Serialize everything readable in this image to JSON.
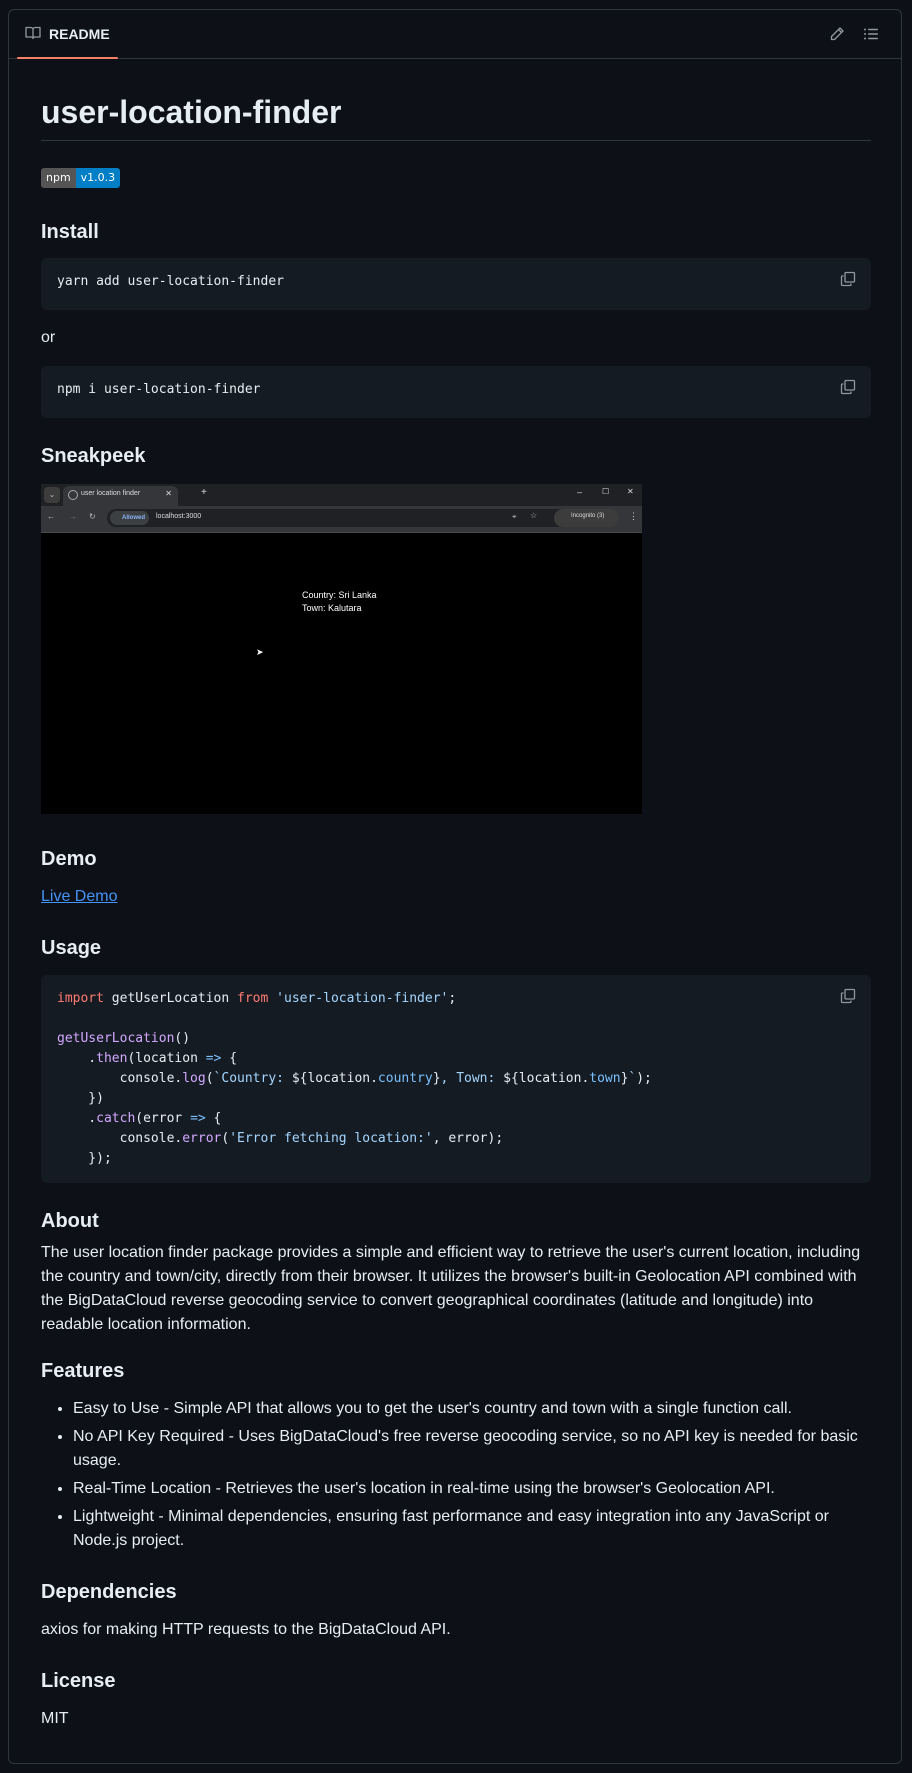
{
  "header": {
    "tab_label": "README"
  },
  "title": "user-location-finder",
  "badge": {
    "left": "npm",
    "right": "v1.0.3"
  },
  "install": {
    "heading": "Install",
    "cmd1": "yarn add user-location-finder",
    "or": "or",
    "cmd2": "npm i user-location-finder"
  },
  "sneakpeek": {
    "heading": "Sneakpeek",
    "tab_title": "user location finder",
    "allowed": "Allowed",
    "url": "localhost:3000",
    "incognito": "Incognito (3)",
    "country": "Country: Sri Lanka",
    "town": "Town: Kalutara"
  },
  "demo": {
    "heading": "Demo",
    "link": "Live Demo"
  },
  "usage": {
    "heading": "Usage",
    "code": {
      "l1_import": "import",
      "l1_name": " getUserLocation ",
      "l1_from": "from",
      "l1_str": "'user-location-finder'",
      "l1_end": ";",
      "l3_fn": "getUserLocation",
      "l3_end": "()",
      "l4_dot": "    .",
      "l4_fn": "then",
      "l4_a": "(location ",
      "l4_arrow": "=>",
      "l4_b": " {",
      "l5_a": "        console.",
      "l5_fn": "log",
      "l5_b": "(",
      "l5_s1": "`Country: ",
      "l5_v1": "${location.",
      "l5_p1": "country",
      "l5_v1e": "}",
      "l5_s2": ", Town: ",
      "l5_v2": "${location.",
      "l5_p2": "town",
      "l5_v2e": "}",
      "l5_s3": "`",
      "l5_end": ");",
      "l6": "    })",
      "l7_dot": "    .",
      "l7_fn": "catch",
      "l7_a": "(error ",
      "l7_arrow": "=>",
      "l7_b": " {",
      "l8_a": "        console.",
      "l8_fn": "error",
      "l8_b": "(",
      "l8_str": "'Error fetching location:'",
      "l8_end": ", error);",
      "l9": "    });"
    }
  },
  "about": {
    "heading": "About",
    "text": "The user location finder package provides a simple and efficient way to retrieve the user's current location, including the country and town/city, directly from their browser. It utilizes the browser's built-in Geolocation API combined with the BigDataCloud reverse geocoding service to convert geographical coordinates (latitude and longitude) into readable location information."
  },
  "features": {
    "heading": "Features",
    "items": [
      "Easy to Use - Simple API that allows you to get the user's country and town with a single function call.",
      "No API Key Required - Uses BigDataCloud's free reverse geocoding service, so no API key is needed for basic usage.",
      "Real-Time Location - Retrieves the user's location in real-time using the browser's Geolocation API.",
      "Lightweight - Minimal dependencies, ensuring fast performance and easy integration into any JavaScript or Node.js project."
    ]
  },
  "dependencies": {
    "heading": "Dependencies",
    "text": "axios for making HTTP requests to the BigDataCloud API."
  },
  "license": {
    "heading": "License",
    "text": "MIT"
  }
}
